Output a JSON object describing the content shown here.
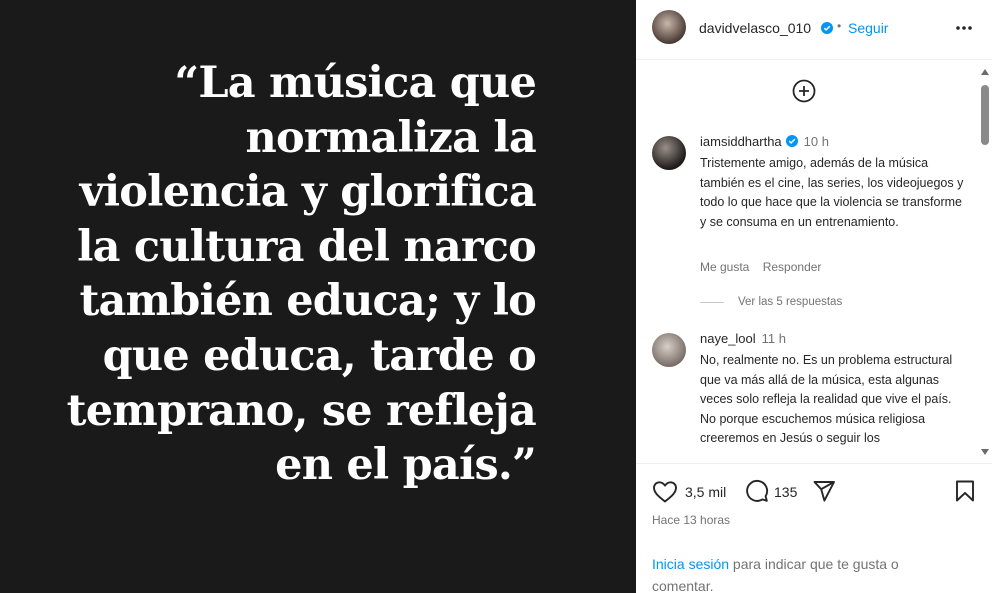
{
  "post": {
    "quote": "“La música que\nnormaliza la\nviolencia y glorifica\nla cultura del narco\ntambién educa; y lo\nque educa, tarde o\ntemprano, se refleja\nen el país.”"
  },
  "header": {
    "username": "davidvelasco_010",
    "separator": "•",
    "follow": "Seguir",
    "more_icon": "more-horizontal-icon"
  },
  "comments": [
    {
      "username": "iamsiddhartha",
      "verified": true,
      "time": "10 h",
      "text": "Tristemente amigo, además de la música también es el cine, las series, los videojuegos y todo lo que hace que la violencia se transforme y se consuma en un entrenamiento.",
      "like_label": "Me gusta",
      "reply_label": "Responder",
      "view_replies": "Ver las 5 respuestas"
    },
    {
      "username": "naye_lool",
      "verified": false,
      "time": "11 h",
      "text": "No, realmente no. Es un problema estructural que va más allá de la música, esta algunas veces solo refleja la realidad que vive el país. No porque escuchemos música religiosa creeremos en Jesús o seguir los"
    }
  ],
  "actions": {
    "likes": "3,5 mil",
    "comments": "135",
    "time_ago": "Hace 13 horas",
    "login_link": "Inicia sesión",
    "login_rest": " para indicar que te gusta o comentar."
  },
  "colors": {
    "accent": "#0095f6",
    "image_bg": "#1a1a1a",
    "muted_text": "#737373"
  }
}
